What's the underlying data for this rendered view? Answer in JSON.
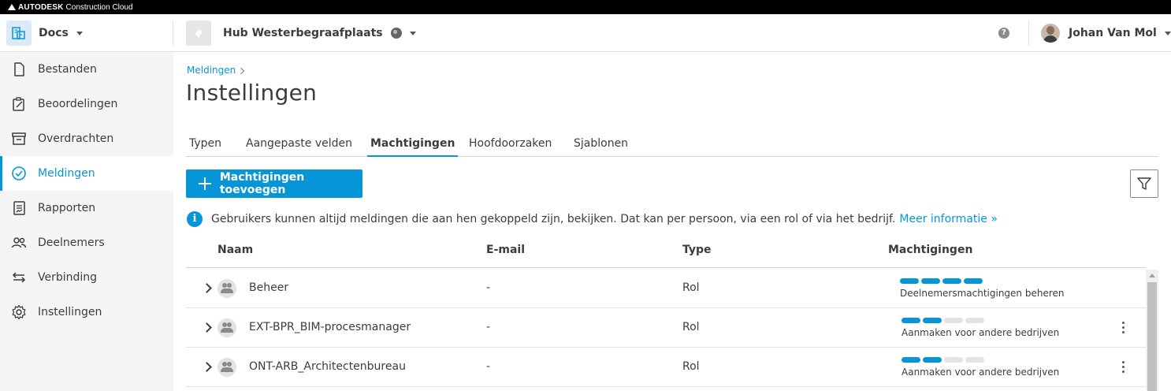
{
  "topbar": {
    "brand": "AUTODESK",
    "product": "Construction Cloud"
  },
  "header": {
    "app_label": "Docs",
    "project_label": "Hub Westerbegraafplaats",
    "help_glyph": "?",
    "user_name": "Johan Van Mol"
  },
  "sidebar": {
    "items": [
      {
        "label": "Bestanden",
        "icon": "file-icon",
        "active": false
      },
      {
        "label": "Beoordelingen",
        "icon": "review-clipboard-icon",
        "active": false
      },
      {
        "label": "Overdrachten",
        "icon": "transmittal-tray-icon",
        "active": false
      },
      {
        "label": "Meldingen",
        "icon": "check-circle-icon",
        "active": true
      },
      {
        "label": "Rapporten",
        "icon": "report-icon",
        "active": false
      },
      {
        "label": "Deelnemers",
        "icon": "members-icon",
        "active": false
      },
      {
        "label": "Verbinding",
        "icon": "arrows-exchange-icon",
        "active": false
      },
      {
        "label": "Instellingen",
        "icon": "gear-icon",
        "active": false
      }
    ]
  },
  "breadcrumb": {
    "label": "Meldingen"
  },
  "page_title": "Instellingen",
  "tabs": [
    {
      "label": "Typen",
      "active": false
    },
    {
      "label": "Aangepaste velden",
      "active": false
    },
    {
      "label": "Machtigingen",
      "active": true
    },
    {
      "label": "Hoofdoorzaken",
      "active": false
    },
    {
      "label": "Sjablonen",
      "active": false
    }
  ],
  "toolbar": {
    "add_label": "Machtigingen toevoegen"
  },
  "info": {
    "glyph": "i",
    "text": "Gebruikers kunnen altijd meldingen die aan hen gekoppeld zijn, bekijken. Dat kan per persoon, via een rol of via het bedrijf.",
    "link": "Meer informatie »"
  },
  "table": {
    "columns": [
      "Naam",
      "E-mail",
      "Type",
      "Machtigingen"
    ],
    "rows": [
      {
        "name": "Beheer",
        "email": "-",
        "type": "Rol",
        "permission_level": 4,
        "permission_max": 4,
        "permission_label": "Deelnemersmachtigingen beheren"
      },
      {
        "name": "EXT-BPR_BIM-procesmanager",
        "email": "-",
        "type": "Rol",
        "permission_level": 2,
        "permission_max": 4,
        "permission_label": "Aanmaken voor andere bedrijven"
      },
      {
        "name": "ONT-ARB_Architectenbureau",
        "email": "-",
        "type": "Rol",
        "permission_level": 2,
        "permission_max": 4,
        "permission_label": "Aanmaken voor andere bedrijven"
      }
    ]
  },
  "colors": {
    "accent": "#0696d7",
    "sidebar_bg": "#f5f5f5",
    "topbar_bg": "#000000"
  }
}
